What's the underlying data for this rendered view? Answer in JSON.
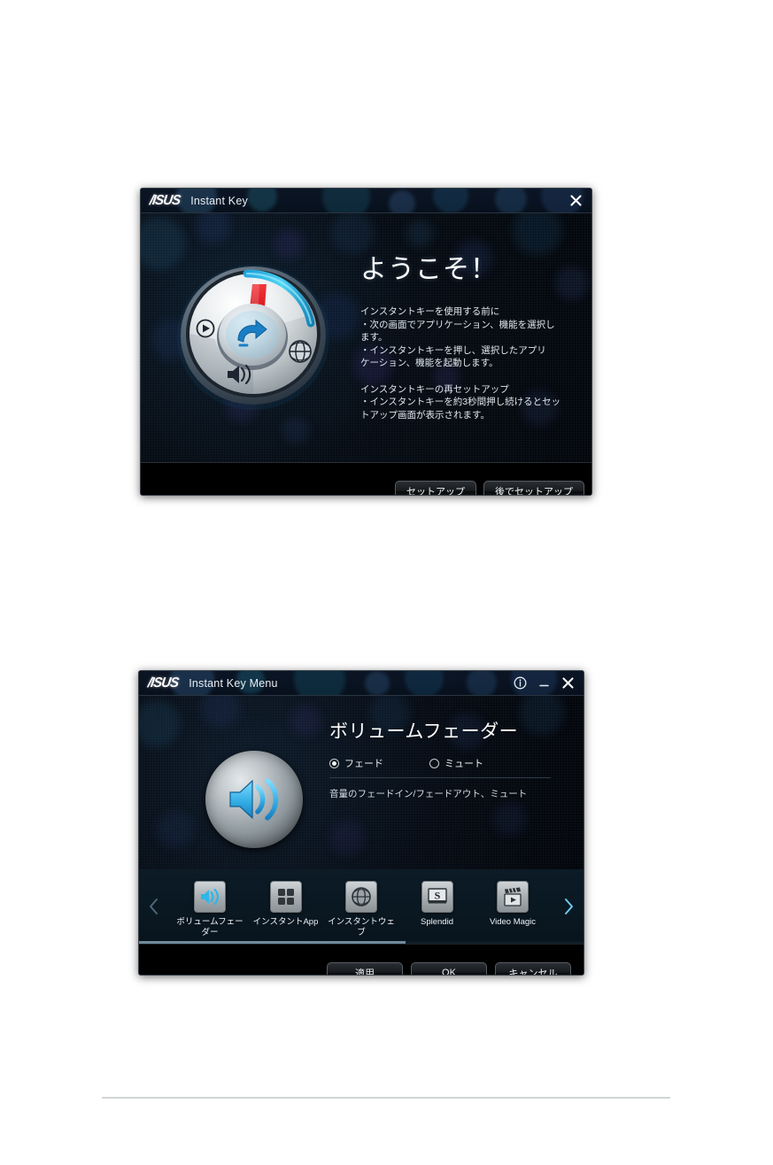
{
  "welcome_dialog": {
    "brand_logo": "asus-logo",
    "title": "Instant Key",
    "close_icon": "close-icon",
    "heading": "ようこそ！",
    "section1_title": "インスタントキーを使用する前に",
    "section1_line1": "・次の画面でアプリケーション、機能を選択し",
    "section1_line2": "ます。",
    "section1_line3": "・インスタントキーを押し、選択したアプリ",
    "section1_line4": "ケーション、機能を起動します。",
    "section2_title": "インスタントキーの再セットアップ",
    "section2_line1": "・インスタントキーを約3秒間押し続けるとセッ",
    "section2_line2": "トアップ画面が表示されます。",
    "button_setup": "セットアップ",
    "button_setup_later": "後でセットアップ",
    "dial_icons": {
      "play": "play-icon",
      "globe": "globe-icon",
      "volume": "speaker-icon",
      "center": "instant-key-arrow-icon",
      "pointer": "red-pointer-icon"
    }
  },
  "menu_dialog": {
    "brand_logo": "asus-logo",
    "title": "Instant Key Menu",
    "info_icon": "info-icon",
    "minimize_icon": "minimize-icon",
    "close_icon": "close-icon",
    "feature_icon": "speaker-icon",
    "feature_title": "ボリュームフェーダー",
    "radio_options": [
      {
        "label": "フェード",
        "selected": true
      },
      {
        "label": "ミュート",
        "selected": false
      }
    ],
    "description": "音量のフェードイン/フェードアウト、ミュート",
    "nav_prev_icon": "chevron-left-icon",
    "nav_next_icon": "chevron-right-icon",
    "strip_items": [
      {
        "label": "ボリュームフェー\nダー",
        "icon": "speaker-icon",
        "selected": true
      },
      {
        "label": "インスタントApp",
        "icon": "apps-grid-icon",
        "selected": false
      },
      {
        "label": "インスタントウェブ",
        "icon": "globe-icon",
        "selected": false
      },
      {
        "label": "Splendid",
        "icon": "splendid-monitor-icon",
        "selected": false
      },
      {
        "label": "Video Magic",
        "icon": "video-clapper-icon",
        "selected": false
      }
    ],
    "button_apply": "適用",
    "button_ok": "OK",
    "button_cancel": "キャンセル"
  },
  "colors": {
    "accent_cyan": "#35c6f4",
    "dialog_bg": "#05080c",
    "footer_bg": "#000000",
    "text_primary": "#ffffff",
    "red_pointer": "#d8151c"
  }
}
